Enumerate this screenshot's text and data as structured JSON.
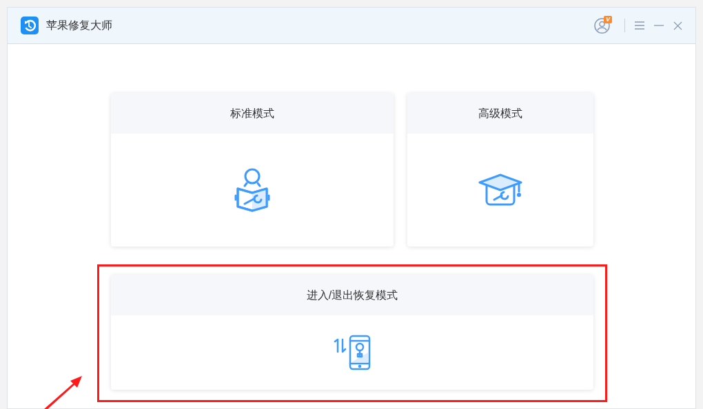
{
  "window": {
    "title": "苹果修复大师",
    "vip_badge": "V"
  },
  "modes": [
    {
      "kind": "standard",
      "title": "标准模式"
    },
    {
      "kind": "advanced",
      "title": "高级模式"
    },
    {
      "kind": "recovery",
      "title": "进入/退出恢复模式"
    }
  ]
}
